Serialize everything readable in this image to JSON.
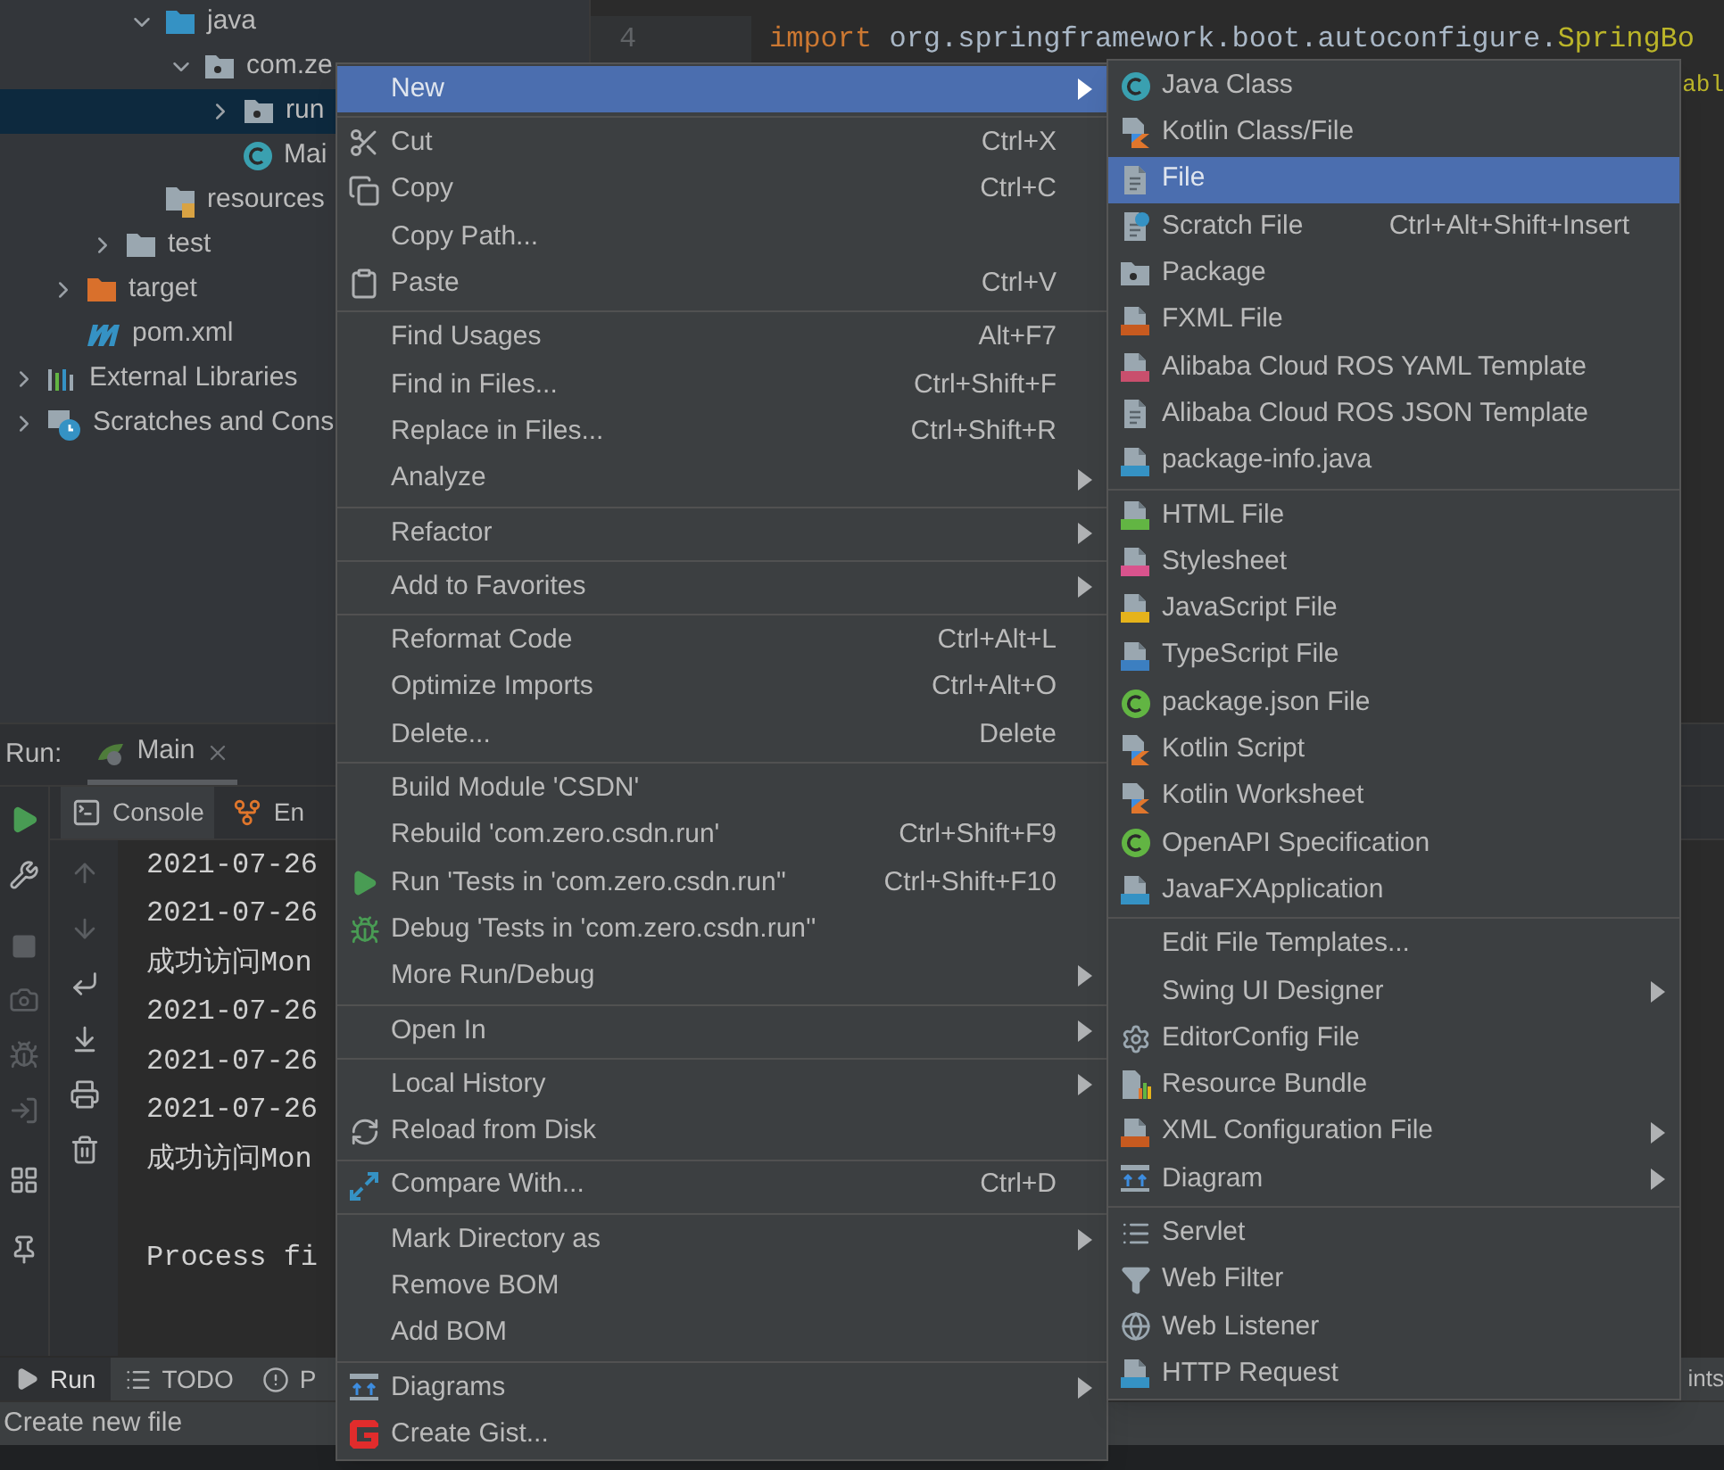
{
  "project_tree": {
    "items": [
      {
        "children": [
          {
            "children": [
              {
                "children": [
                  {
                    "label": "java",
                    "kind": "source-folder",
                    "expanded": true,
                    "selected": false,
                    "children": [
                      {
                        "label": "com.ze",
                        "kind": "package",
                        "expanded": true,
                        "selected": false,
                        "children": [
                          {
                            "label": "run",
                            "kind": "package",
                            "expanded": false,
                            "selected": true
                          },
                          {
                            "label": "Mai",
                            "kind": "class",
                            "selected": false
                          }
                        ]
                      }
                    ]
                  },
                  {
                    "label": "resources",
                    "kind": "resources-folder",
                    "selected": false
                  }
                ]
              },
              {
                "label": "test",
                "kind": "folder",
                "expanded": false,
                "selected": false
              }
            ]
          },
          {
            "label": "target",
            "kind": "excluded-folder",
            "expanded": false,
            "selected": false
          },
          {
            "label": "pom.xml",
            "kind": "maven-file",
            "selected": false
          }
        ]
      },
      {
        "label": "External Libraries",
        "kind": "libraries",
        "expanded": false,
        "selected": false
      },
      {
        "label": "Scratches and Cons",
        "kind": "scratches",
        "expanded": false,
        "selected": false
      }
    ]
  },
  "editor": {
    "lines": [
      {
        "number": "4",
        "tokens": [
          {
            "text": "import ",
            "kind": "keyword"
          },
          {
            "text": "org.springframework.boot.autoconfigure.",
            "kind": "plain"
          },
          {
            "text": "SpringBo",
            "kind": "annotation"
          }
        ]
      },
      {
        "tokens": [
          {
            "text": "abl",
            "kind": "annotation"
          }
        ]
      }
    ]
  },
  "run_panel": {
    "label": "Run:",
    "tabs": [
      {
        "label": "Main",
        "selected": true
      }
    ],
    "toolbar_tabs": [
      {
        "label": "Console",
        "selected": true,
        "kind": "console"
      },
      {
        "label": "En",
        "selected": false,
        "kind": "endpoints"
      }
    ],
    "console_lines": [
      "2021-07-26",
      "2021-07-26",
      "成功访问Mon",
      "2021-07-26",
      "2021-07-26",
      "2021-07-26",
      "成功访问Mon"
    ],
    "exit_message": "Process fi"
  },
  "bottom_bar": {
    "tabs": [
      {
        "label": "Run",
        "selected": true,
        "kind": "run"
      },
      {
        "label": "TODO",
        "selected": false,
        "kind": "todo"
      },
      {
        "label": "P",
        "selected": false,
        "kind": "problems"
      }
    ],
    "right_tab": "ints"
  },
  "status_bar": {
    "text": "Create new file"
  },
  "context_menu": {
    "groups": [
      [
        {
          "label": "New",
          "submenu": true,
          "selected": true
        }
      ],
      [
        {
          "label": "Cut",
          "shortcut": "Ctrl+X",
          "submenu": false,
          "selected": false
        },
        {
          "label": "Copy",
          "shortcut": "Ctrl+C",
          "submenu": false,
          "selected": false
        },
        {
          "label": "Copy Path...",
          "submenu": false,
          "selected": false
        },
        {
          "label": "Paste",
          "shortcut": "Ctrl+V",
          "submenu": false,
          "selected": false
        }
      ],
      [
        {
          "label": "Find Usages",
          "shortcut": "Alt+F7",
          "submenu": false,
          "selected": false
        },
        {
          "label": "Find in Files...",
          "shortcut": "Ctrl+Shift+F",
          "submenu": false,
          "selected": false
        },
        {
          "label": "Replace in Files...",
          "shortcut": "Ctrl+Shift+R",
          "submenu": false,
          "selected": false
        },
        {
          "label": "Analyze",
          "submenu": true,
          "selected": false
        }
      ],
      [
        {
          "label": "Refactor",
          "submenu": true,
          "selected": false
        }
      ],
      [
        {
          "label": "Add to Favorites",
          "submenu": true,
          "selected": false
        }
      ],
      [
        {
          "label": "Reformat Code",
          "shortcut": "Ctrl+Alt+L",
          "submenu": false,
          "selected": false
        },
        {
          "label": "Optimize Imports",
          "shortcut": "Ctrl+Alt+O",
          "submenu": false,
          "selected": false
        },
        {
          "label": "Delete...",
          "shortcut": "Delete",
          "submenu": false,
          "selected": false
        }
      ],
      [
        {
          "label": "Build Module 'CSDN'",
          "submenu": false,
          "selected": false
        },
        {
          "label": "Rebuild 'com.zero.csdn.run'",
          "shortcut": "Ctrl+Shift+F9",
          "submenu": false,
          "selected": false
        },
        {
          "label": "Run 'Tests in 'com.zero.csdn.run''",
          "shortcut": "Ctrl+Shift+F10",
          "submenu": false,
          "selected": false
        },
        {
          "label": "Debug 'Tests in 'com.zero.csdn.run''",
          "submenu": false,
          "selected": false
        },
        {
          "label": "More Run/Debug",
          "submenu": true,
          "selected": false
        }
      ],
      [
        {
          "label": "Open In",
          "submenu": true,
          "selected": false
        }
      ],
      [
        {
          "label": "Local History",
          "submenu": true,
          "selected": false
        },
        {
          "label": "Reload from Disk",
          "submenu": false,
          "selected": false
        }
      ],
      [
        {
          "label": "Compare With...",
          "shortcut": "Ctrl+D",
          "submenu": false,
          "selected": false
        }
      ],
      [
        {
          "label": "Mark Directory as",
          "submenu": true,
          "selected": false
        },
        {
          "label": "Remove BOM",
          "submenu": false,
          "selected": false
        },
        {
          "label": "Add BOM",
          "submenu": false,
          "selected": false
        }
      ],
      [
        {
          "label": "Diagrams",
          "submenu": true,
          "selected": false
        },
        {
          "label": "Create Gist...",
          "submenu": false,
          "selected": false
        }
      ]
    ]
  },
  "new_submenu": {
    "groups": [
      [
        {
          "label": "Java Class",
          "submenu": false,
          "selected": false
        },
        {
          "label": "Kotlin Class/File",
          "submenu": false,
          "selected": false
        },
        {
          "label": "File",
          "submenu": false,
          "selected": true
        },
        {
          "label": "Scratch File",
          "shortcut": "Ctrl+Alt+Shift+Insert",
          "submenu": false,
          "selected": false
        },
        {
          "label": "Package",
          "submenu": false,
          "selected": false
        },
        {
          "label": "FXML File",
          "submenu": false,
          "selected": false
        },
        {
          "label": "Alibaba Cloud ROS YAML Template",
          "submenu": false,
          "selected": false
        },
        {
          "label": "Alibaba Cloud ROS JSON Template",
          "submenu": false,
          "selected": false
        },
        {
          "label": "package-info.java",
          "submenu": false,
          "selected": false
        }
      ],
      [
        {
          "label": "HTML File",
          "submenu": false,
          "selected": false
        },
        {
          "label": "Stylesheet",
          "submenu": false,
          "selected": false
        },
        {
          "label": "JavaScript File",
          "submenu": false,
          "selected": false
        },
        {
          "label": "TypeScript File",
          "submenu": false,
          "selected": false
        },
        {
          "label": "package.json File",
          "submenu": false,
          "selected": false
        },
        {
          "label": "Kotlin Script",
          "submenu": false,
          "selected": false
        },
        {
          "label": "Kotlin Worksheet",
          "submenu": false,
          "selected": false
        },
        {
          "label": "OpenAPI Specification",
          "submenu": false,
          "selected": false
        },
        {
          "label": "JavaFXApplication",
          "submenu": false,
          "selected": false
        }
      ],
      [
        {
          "label": "Edit File Templates...",
          "submenu": false,
          "selected": false
        },
        {
          "label": "Swing UI Designer",
          "submenu": true,
          "selected": false
        },
        {
          "label": "EditorConfig File",
          "submenu": false,
          "selected": false
        },
        {
          "label": "Resource Bundle",
          "submenu": false,
          "selected": false
        },
        {
          "label": "XML Configuration File",
          "submenu": true,
          "selected": false
        },
        {
          "label": "Diagram",
          "submenu": true,
          "selected": false
        }
      ],
      [
        {
          "label": "Servlet",
          "submenu": false,
          "selected": false
        },
        {
          "label": "Web Filter",
          "submenu": false,
          "selected": false
        },
        {
          "label": "Web Listener",
          "submenu": false,
          "selected": false
        },
        {
          "label": "HTTP Request",
          "submenu": false,
          "selected": false
        }
      ]
    ]
  }
}
